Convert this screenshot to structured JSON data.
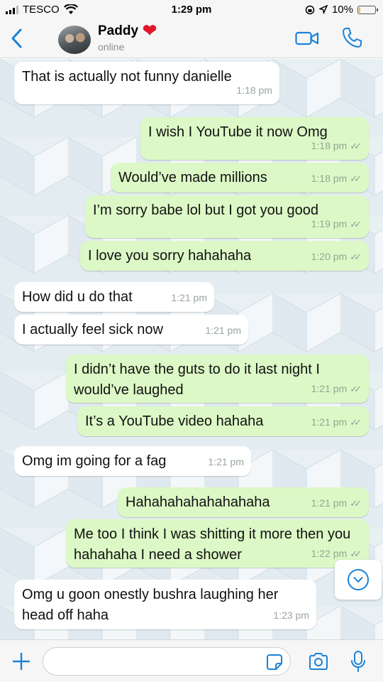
{
  "status_bar": {
    "carrier": "TESCO",
    "time": "1:29 pm",
    "battery": "10%",
    "battery_level": 0.1
  },
  "header": {
    "contact_name": "Paddy",
    "contact_emoji": "❤",
    "status": "online"
  },
  "icons": {
    "back": "chevron-left-icon",
    "video": "video-call-icon",
    "call": "phone-icon",
    "plus": "plus-icon",
    "sticker": "sticker-icon",
    "camera": "camera-icon",
    "mic": "microphone-icon"
  },
  "colors": {
    "accent": "#1b82d8",
    "outgoing_bubble": "#dcf8c6",
    "incoming_bubble": "#ffffff"
  },
  "messages": [
    {
      "dir": "in",
      "text": "That is actually not funny danielle",
      "time": "1:18 pm"
    },
    {
      "dir": "out",
      "text": "I wish I YouTube it now Omg",
      "time": "1:18 pm"
    },
    {
      "dir": "out",
      "text": "Would’ve made millions",
      "time": "1:18 pm"
    },
    {
      "dir": "out",
      "text": "I’m sorry babe lol but I got you good",
      "time": "1:19 pm"
    },
    {
      "dir": "out",
      "text": "I love you sorry hahahaha",
      "time": "1:20 pm"
    },
    {
      "dir": "in",
      "text": "How did u do that",
      "time": "1:21 pm"
    },
    {
      "dir": "in",
      "text": "I actually feel sick now",
      "time": "1:21 pm"
    },
    {
      "dir": "out",
      "text": "I didn’t have the guts to do it last night I would’ve laughed",
      "time": "1:21 pm"
    },
    {
      "dir": "out",
      "text": "It’s a YouTube video hahaha",
      "time": "1:21 pm"
    },
    {
      "dir": "in",
      "text": "Omg im going for a fag",
      "time": "1:21 pm"
    },
    {
      "dir": "out",
      "text": "Hahahahahahahahaha",
      "time": "1:21 pm"
    },
    {
      "dir": "out",
      "text": "Me too I think I was shitting it more then you hahahaha I need a shower",
      "time": "1:22 pm"
    },
    {
      "dir": "in",
      "text": "Omg u goon onestly bushra laughing her head off haha",
      "time": "1:23 pm"
    }
  ],
  "input": {
    "placeholder": ""
  }
}
